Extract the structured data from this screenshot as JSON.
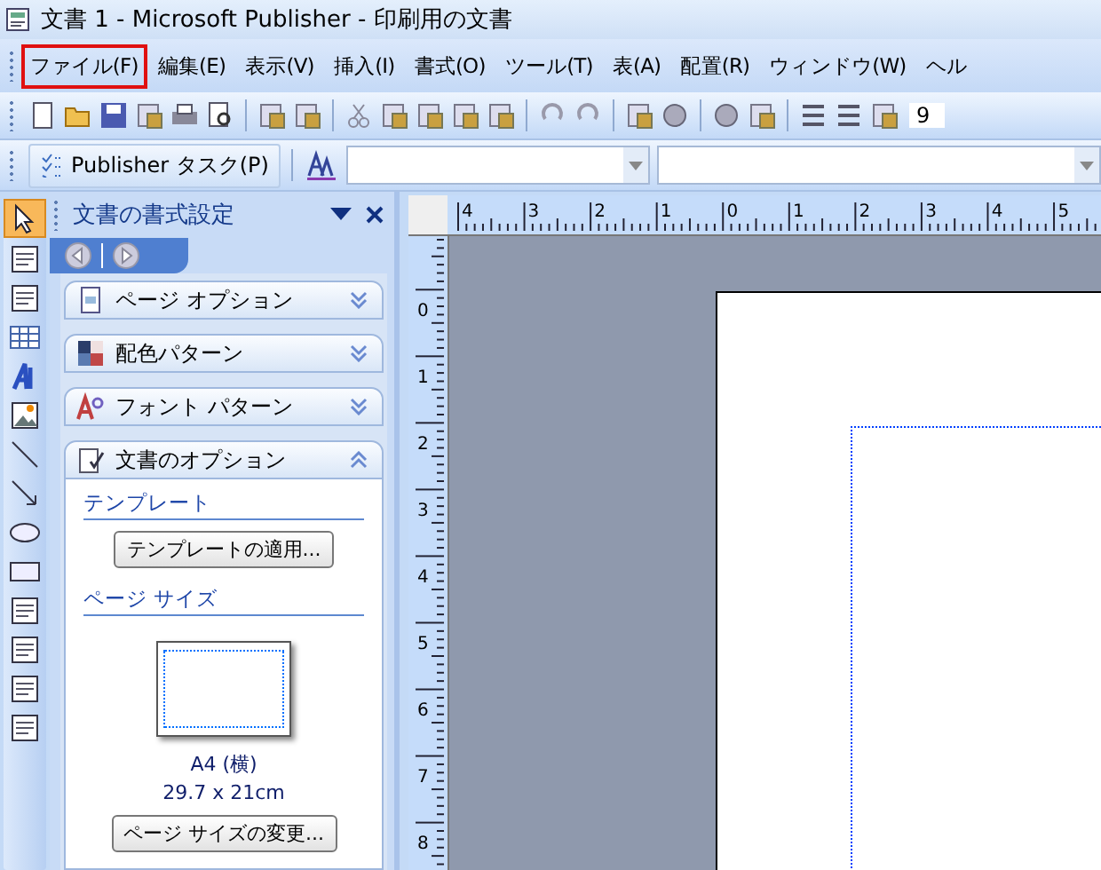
{
  "window": {
    "title": "文書 1 - Microsoft Publisher - 印刷用の文書"
  },
  "menu": [
    {
      "label": "ファイル(F)",
      "highlighted": true
    },
    {
      "label": "編集(E)",
      "highlighted": false
    },
    {
      "label": "表示(V)",
      "highlighted": false
    },
    {
      "label": "挿入(I)",
      "highlighted": false
    },
    {
      "label": "書式(O)",
      "highlighted": false
    },
    {
      "label": "ツール(T)",
      "highlighted": false
    },
    {
      "label": "表(A)",
      "highlighted": false
    },
    {
      "label": "配置(R)",
      "highlighted": false
    },
    {
      "label": "ウィンドウ(W)",
      "highlighted": false
    },
    {
      "label": "ヘル",
      "highlighted": false
    }
  ],
  "toolbar": {
    "font_size": "9"
  },
  "format_toolbar": {
    "tasks_button": "Publisher タスク(P)"
  },
  "task_pane": {
    "title": "文書の書式設定",
    "sections": [
      {
        "label": "ページ オプション",
        "expanded": false
      },
      {
        "label": "配色パターン",
        "expanded": false
      },
      {
        "label": "フォント パターン",
        "expanded": false
      },
      {
        "label": "文書のオプション",
        "expanded": true
      }
    ],
    "template_heading": "テンプレート",
    "apply_template_button": "テンプレートの適用...",
    "page_size_heading": "ページ サイズ",
    "page_size_name": "A4 (横)",
    "page_size_dimensions": "29.7 x 21cm",
    "change_page_size_button": "ページ サイズの変更..."
  },
  "horizontal_ruler": [
    "4",
    "3",
    "2",
    "1",
    "0",
    "1",
    "2",
    "3",
    "4",
    "5"
  ],
  "vertical_ruler": [
    "0",
    "1",
    "2",
    "3",
    "4",
    "5",
    "6",
    "7",
    "8"
  ]
}
